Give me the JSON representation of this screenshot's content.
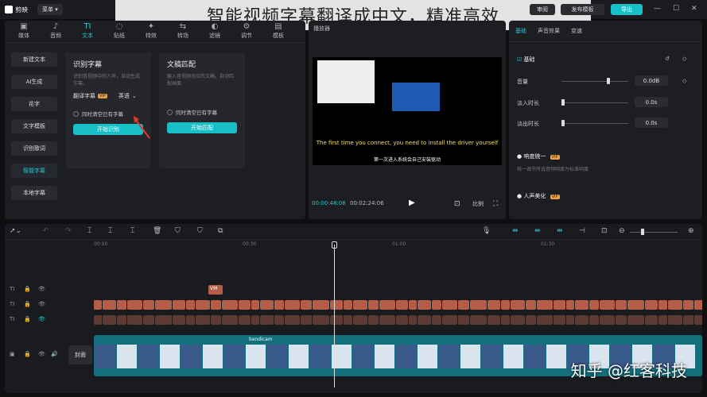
{
  "topbar": {
    "app": "剪映",
    "menu": "菜单",
    "buttons": [
      "审阅",
      "发布模板",
      "导出"
    ]
  },
  "banner": "智能视频字幕翻译成中文，精准高效",
  "tabs": [
    {
      "icon": "▣",
      "label": "媒体"
    },
    {
      "icon": "♪",
      "label": "音频"
    },
    {
      "icon": "TI",
      "label": "文本"
    },
    {
      "icon": "◌",
      "label": "贴纸"
    },
    {
      "icon": "✦",
      "label": "特效"
    },
    {
      "icon": "⇆",
      "label": "转场"
    },
    {
      "icon": "◐",
      "label": "滤镜"
    },
    {
      "icon": "⚙",
      "label": "调节"
    },
    {
      "icon": "▤",
      "label": "模板"
    }
  ],
  "sidebar": [
    "新建文本",
    "AI生成",
    "花字",
    "文字模板",
    "识别歌词",
    "智能字幕",
    "本地字幕"
  ],
  "card1": {
    "title": "识别字幕",
    "desc": "识别音视频中的人声，自动生成字幕。",
    "translate": "翻译字幕",
    "vip": "VIP",
    "lang": "英语",
    "chk": "同时清空已有字幕",
    "btn": "开始识别"
  },
  "card2": {
    "title": "文稿匹配",
    "desc": "输入音视频对应的文稿，自动匹配画面",
    "chk": "同时清空已有字幕",
    "btn": "开始匹配"
  },
  "player": {
    "title": "播放器",
    "sub1": "The first time you connect, you need to install the driver yourself",
    "sub2": "第一次进入系统会自己安装驱动",
    "time_cur": "00:00:48:08",
    "time_total": "00:02:24:06",
    "ratio": "比例"
  },
  "inspector": {
    "tabs": [
      "基础",
      "声音效果",
      "变速"
    ],
    "section": "基础",
    "volume": "音量",
    "volume_val": "0.0dB",
    "fadein": "淡入时长",
    "fadein_val": "0.0s",
    "fadeout": "淡出时长",
    "fadeout_val": "0.0s",
    "loud": "响度统一",
    "loud_desc": "统一调节所选音频响度为标准响度",
    "vip": "VIP",
    "enhance": "人声美化"
  },
  "timeline": {
    "ruler": [
      "00:00",
      "00:30",
      "01:00",
      "01:30"
    ],
    "cover": "封面",
    "track_clip": "VM",
    "video_label": "bandicam"
  },
  "watermark": "知乎 @红客科技"
}
